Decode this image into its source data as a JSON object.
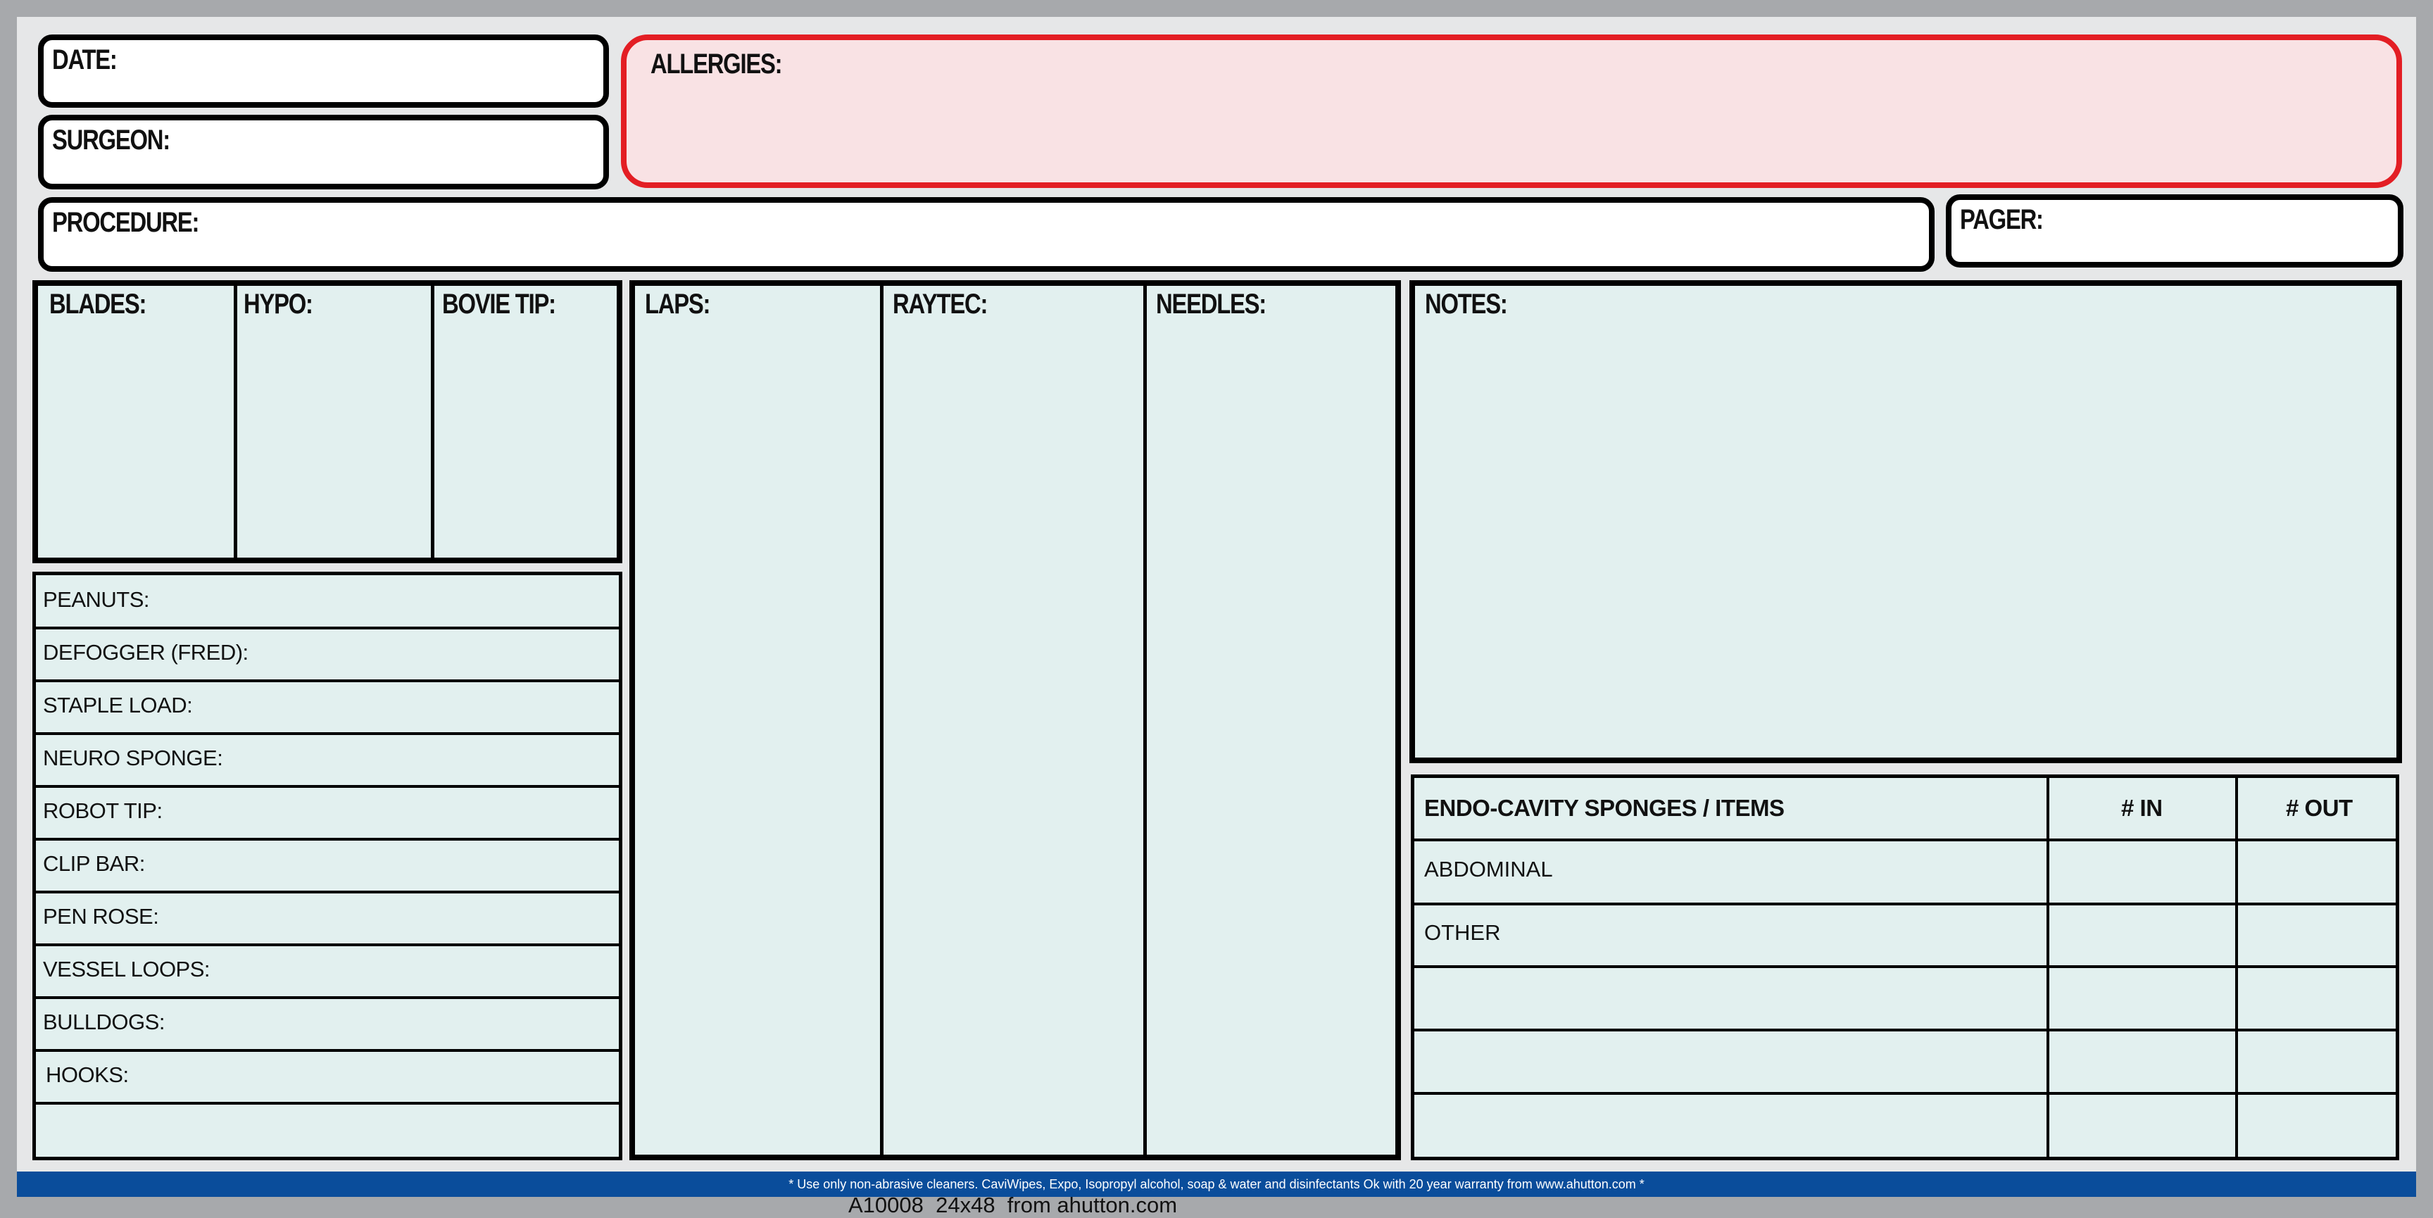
{
  "header": {
    "date_label": "DATE:",
    "surgeon_label": "SURGEON:",
    "allergies_label": "ALLERGIES:",
    "procedure_label": "PROCEDURE:",
    "pager_label": "PAGER:"
  },
  "tools": {
    "blades_label": "BLADES:",
    "hypo_label": "HYPO:",
    "bovie_tip_label": "BOVIE TIP:"
  },
  "counts": {
    "laps_label": "LAPS:",
    "raytec_label": "RAYTEC:",
    "needles_label": "NEEDLES:"
  },
  "notes": {
    "label": "NOTES:"
  },
  "item_list": {
    "rows": [
      "PEANUTS:",
      "DEFOGGER (FRED):",
      "STAPLE LOAD:",
      "NEURO SPONGE:",
      "ROBOT TIP:",
      "CLIP BAR:",
      "PEN ROSE:",
      "VESSEL LOOPS:",
      "BULLDOGS:",
      "HOOKS:",
      ""
    ]
  },
  "endo_table": {
    "headers": [
      "ENDO-CAVITY SPONGES / ITEMS",
      "# IN",
      "# OUT"
    ],
    "rows": [
      "ABDOMINAL",
      "OTHER",
      "",
      "",
      ""
    ]
  },
  "colors": {
    "allergies_fill": "#f9e2e4",
    "allergies_border": "#e31e24",
    "panel_fill": "#e2f0ef",
    "footer_band": "#0a4d9b"
  },
  "footer": {
    "notice": "* Use only non-abrasive cleaners. CaviWipes, Expo, Isopropyl alcohol, soap & water and disinfectants Ok with 20 year warranty from www.ahutton.com *",
    "sku": "A10008  24x48  from ahutton.com"
  }
}
